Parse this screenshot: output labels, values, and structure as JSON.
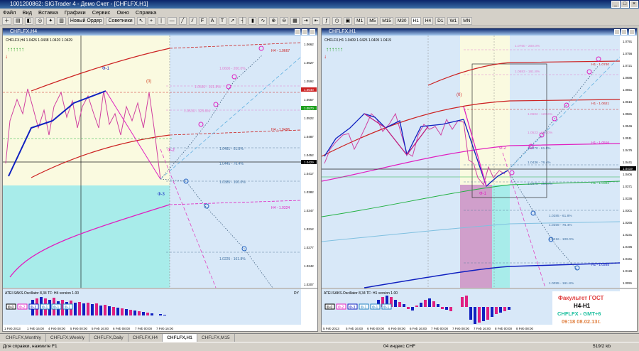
{
  "app": {
    "title": "1001200862: SIGTrader 4 - Демо Счет - [CHFLFX,H1]"
  },
  "menu": [
    "Файл",
    "Вид",
    "Вставка",
    "Графики",
    "Сервис",
    "Окно",
    "Справка"
  ],
  "toolbar": {
    "new_order": "Новый Ордер",
    "advisors": "Советники",
    "timeframes": [
      "M1",
      "M5",
      "M15",
      "M30",
      "H1",
      "H4",
      "D1",
      "W1",
      "MN"
    ]
  },
  "left_chart": {
    "window_title": "CHFLFX,H4",
    "info": "CHFLFX,H4  1.0426  1.0438  1.0420  1.0429",
    "current_price": "1.0429",
    "price_axis": [
      "1.0662",
      "1.0627",
      "1.0592",
      "1.0557",
      "1.0522",
      "1.0487",
      "1.0452",
      "1.0417",
      "1.0382",
      "1.0347",
      "1.0312",
      "1.0277",
      "1.0242",
      "1.0207"
    ],
    "level_labels": [
      "H4 - 1.0667",
      "H4 - 1.0496",
      "H4 - 1.0324",
      "1.0481 - 61.8%",
      "1.0445 - 76.4%",
      "1.0385 - 100.0%",
      "1.0560 - 161.8%",
      "1.0600 - 200.0%",
      "1.0516 - 123.6%",
      "1.0225 - 161.8%"
    ],
    "wave_labels": [
      "Ф-1",
      "(0)",
      "Ф-2",
      "Ф-3"
    ],
    "red_label": "1.0540",
    "green_label": "1.0570",
    "green_label2": "1.0478",
    "osc_title": "ATEI.SAKS.Oscillator 8,34  TF: H4  version 1.00",
    "osc_tag": "DY",
    "phase_buttons": [
      "Ф-0",
      "Ф-2",
      "Ф-3",
      "Ф-1",
      "Ф-1",
      "Ф-1"
    ],
    "time_axis": [
      "1 Feb 2013",
      "1 Feb 16:00",
      "4 Feb 08:00",
      "5 Feb 00:00",
      "5 Feb 16:00",
      "6 Feb 08:00",
      "7 Feb 00:00",
      "7 Feb 16:00"
    ]
  },
  "right_chart": {
    "window_title": "CHFLFX,H1",
    "info": "CHFLFX,H1  1.0409  1.0425  1.0405  1.0419",
    "current_price": "1.0419",
    "price_axis": [
      "1.0791",
      "1.0756",
      "1.0721",
      "1.0686",
      "1.0651",
      "1.0616",
      "1.0581",
      "1.0546",
      "1.0511",
      "1.0476",
      "1.0441",
      "1.0406",
      "1.0371",
      "1.0336",
      "1.0301",
      "1.0266",
      "1.0231",
      "1.0196",
      "1.0161",
      "1.0126",
      "1.0091"
    ],
    "level_labels": [
      "1.0760 - 200.0%",
      "1.0683 - 161.8%",
      "1.0602 - 123.6%",
      "1.0523 - 100.0%",
      "1.0470 - 61.8%",
      "1.0436 - 76.4%",
      "1.0378 - 100.0%",
      "1.0285 - 61.8%",
      "1.0259 - 76.4%",
      "1.0216 - 100.0%",
      "1.0095 - 161.8%",
      "H1 - 1.0740",
      "H1 - 1.0621",
      "H1 - 1.0516",
      "H1 - 1.0394",
      "H1 - 1.0245"
    ],
    "wave_labels": [
      "(0)",
      "Ф-2",
      "Ф-1"
    ],
    "osc_title": "ATEI.SAKS.Oscillator 8,34  TF: H1  version 1.00",
    "phase_buttons": [
      "Ф-0",
      "Ф-2",
      "Ф-3",
      "Ф-1",
      "Ф-1",
      "Ф-1"
    ],
    "watermark": [
      "Факультет ГОСТ",
      "H4-H1",
      "CHFLFX - GMT+6",
      "09:18  08.02.13г."
    ],
    "time_axis": [
      "5 Feb 2013",
      "5 Feb 16:00",
      "6 Feb 00:00",
      "6 Feb 08:00",
      "6 Feb 16:00",
      "7 Feb 00:00",
      "7 Feb 08:00",
      "7 Feb 16:00",
      "8 Feb 00:00",
      "8 Feb 08:00"
    ]
  },
  "tabs": [
    "CHFLFX,Monthly",
    "CHFLFX,Weekly",
    "CHFLFX,Daily",
    "CHFLFX,H4",
    "CHFLFX,H1",
    "CHFLFX,M15"
  ],
  "active_tab": "CHFLFX,H1",
  "status": {
    "help": "Для справки, нажмите F1",
    "profile": "04 индекс CHF",
    "traffic": "519/2 kb"
  },
  "colors": {
    "buy_band": "#d8e8f8",
    "cyan_zone": "#a8ecea",
    "red_channel": "#cc2222",
    "magenta": "#e020c0",
    "wave": "#1020c0",
    "green": "#20b040"
  }
}
